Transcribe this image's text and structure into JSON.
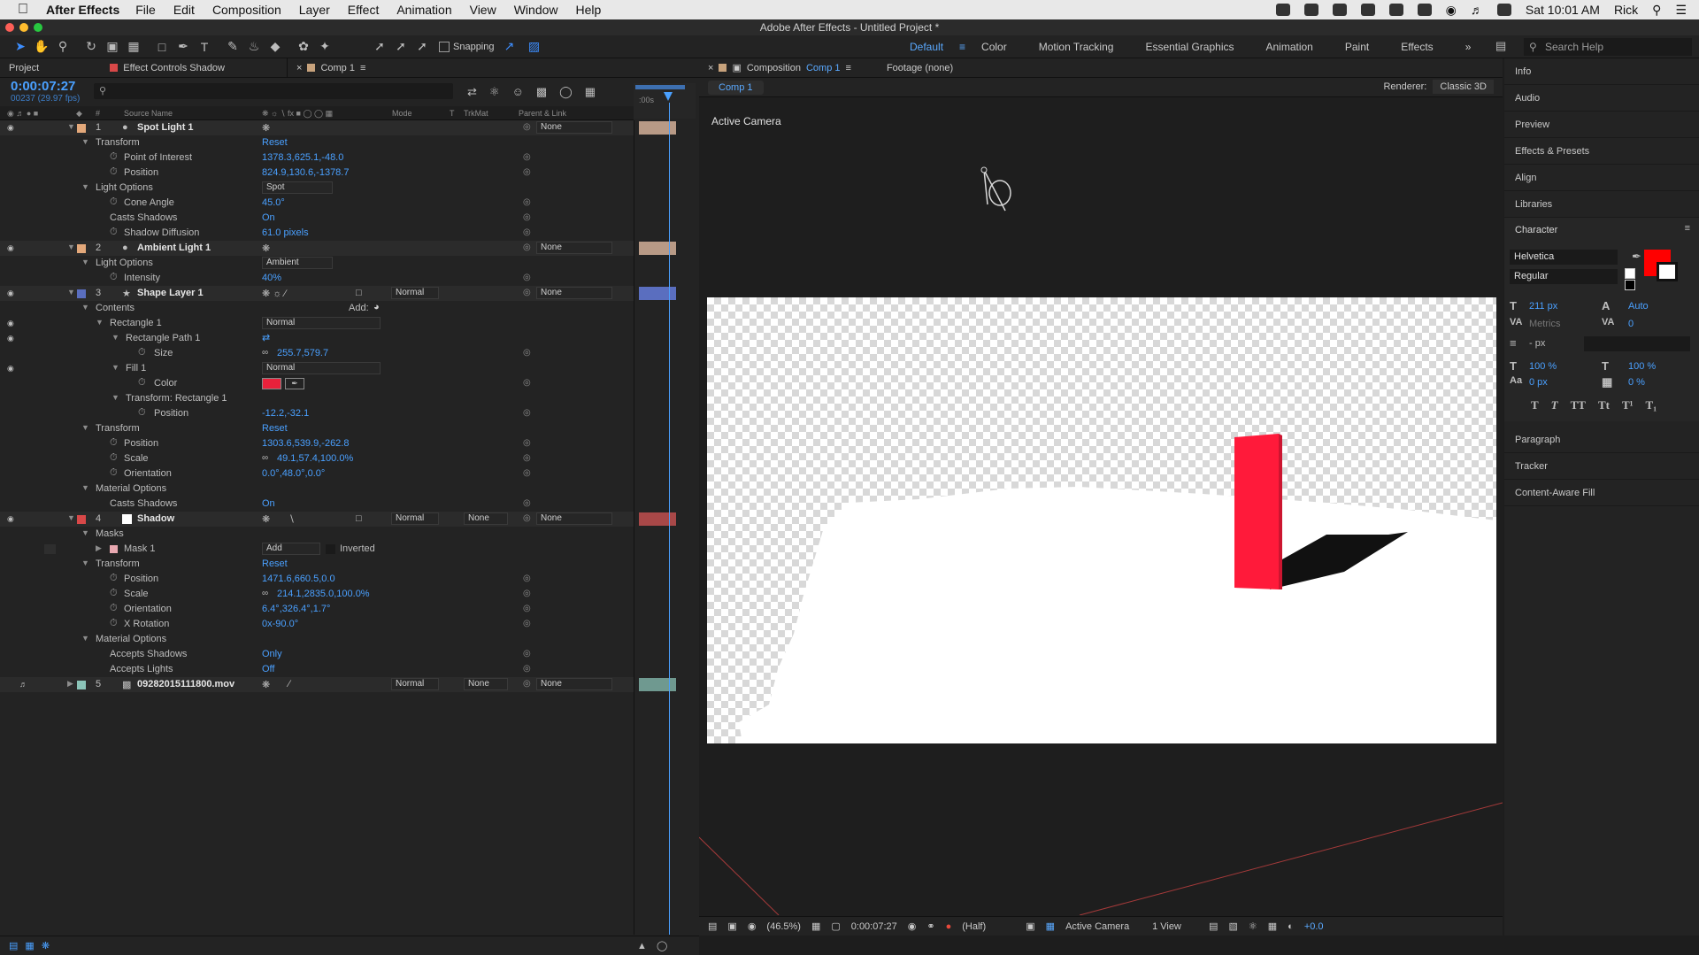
{
  "menubar": {
    "app": "After Effects",
    "items": [
      "File",
      "Edit",
      "Composition",
      "Layer",
      "Effect",
      "Animation",
      "View",
      "Window",
      "Help"
    ],
    "clock": "Sat 10:01 AM",
    "user": "Rick"
  },
  "window": {
    "title": "Adobe After Effects - Untitled Project *"
  },
  "toolbar": {
    "snapping": "Snapping"
  },
  "workspaces": {
    "items": [
      "Default",
      "Color",
      "Motion Tracking",
      "Essential Graphics",
      "Animation",
      "Paint",
      "Effects"
    ],
    "active": "Default"
  },
  "search_help": {
    "placeholder": "Search Help"
  },
  "timeline": {
    "tabs": {
      "project": "Project",
      "effect_controls": "Effect Controls Shadow",
      "comp": "Comp 1"
    },
    "timecode": "0:00:07:27",
    "frames": "00237 (29.97 fps)",
    "columns": {
      "num": "#",
      "source": "Source Name",
      "mode": "Mode",
      "t": "T",
      "trkmat": "TrkMat",
      "parent": "Parent & Link"
    },
    "ruler_label": ":00s",
    "layers": [
      {
        "num": "1",
        "name": "Spot Light 1",
        "color": "#e3a87a",
        "parent": "None"
      },
      {
        "num": "2",
        "name": "Ambient Light 1",
        "color": "#e3a87a",
        "parent": "None"
      },
      {
        "num": "3",
        "name": "Shape Layer 1",
        "color": "#5a6ebf",
        "mode": "Normal",
        "parent": "None"
      },
      {
        "num": "4",
        "name": "Shadow",
        "color": "#d84848",
        "mode": "Normal",
        "trkmat": "None",
        "parent": "None"
      },
      {
        "num": "5",
        "name": "09282015111800.mov",
        "color": "#8bc4b8",
        "mode": "Normal",
        "trkmat": "None",
        "parent": "None"
      }
    ],
    "props": {
      "transform": "Transform",
      "reset": "Reset",
      "point_of_interest": "Point of Interest",
      "poi_val": "1378.3,625.1,-48.0",
      "position": "Position",
      "pos1_val": "824.9,130.6,-1378.7",
      "light_options": "Light Options",
      "spot": "Spot",
      "cone_angle": "Cone Angle",
      "cone_val": "45.0°",
      "casts_shadows": "Casts Shadows",
      "on": "On",
      "shadow_diffusion": "Shadow Diffusion",
      "diff_val": "61.0 pixels",
      "ambient": "Ambient",
      "intensity": "Intensity",
      "int_val": "40%",
      "contents": "Contents",
      "add": "Add:",
      "rectangle1": "Rectangle 1",
      "normal": "Normal",
      "rect_path": "Rectangle Path 1",
      "size": "Size",
      "size_val": "255.7,579.7",
      "fill1": "Fill 1",
      "color": "Color",
      "transform_rect": "Transform: Rectangle 1",
      "rect_pos_val": "-12.2,-32.1",
      "pos3_val": "1303.6,539.9,-262.8",
      "scale": "Scale",
      "scale3_val": "49.1,57.4,100.0%",
      "orientation": "Orientation",
      "orient3_val": "0.0°,48.0°,0.0°",
      "material_options": "Material Options",
      "masks": "Masks",
      "mask1": "Mask 1",
      "add_mode": "Add",
      "inverted": "Inverted",
      "pos4_val": "1471.6,660.5,0.0",
      "scale4_val": "214.1,2835.0,100.0%",
      "orient4_val": "6.4°,326.4°,1.7°",
      "x_rotation": "X Rotation",
      "xrot_val": "0x-90.0°",
      "accepts_shadows": "Accepts Shadows",
      "only": "Only",
      "accepts_lights": "Accepts Lights",
      "off": "Off"
    }
  },
  "composition": {
    "tab": "Composition",
    "tab_name": "Comp 1",
    "footage": "Footage (none)",
    "sub_tab": "Comp 1",
    "renderer_label": "Renderer:",
    "renderer": "Classic 3D",
    "active_camera": "Active Camera",
    "fill_color": "#ff1a3a",
    "viewer_bar": {
      "zoom": "(46.5%)",
      "timecode": "0:00:07:27",
      "resolution": "(Half)",
      "camera": "Active Camera",
      "views": "1 View",
      "exposure": "+0.0"
    }
  },
  "right_panel": {
    "items": [
      "Info",
      "Audio",
      "Preview",
      "Effects & Presets",
      "Align",
      "Libraries"
    ],
    "character": {
      "title": "Character",
      "font": "Helvetica",
      "style": "Regular",
      "size": "211 px",
      "leading": "Auto",
      "kerning": "Metrics",
      "tracking": "0",
      "stroke": "- px",
      "vscale": "100 %",
      "hscale": "100 %",
      "baseline": "0 px",
      "tsume": "0 %",
      "fill_color": "#ff0000"
    },
    "items2": [
      "Paragraph",
      "Tracker",
      "Content-Aware Fill"
    ]
  }
}
